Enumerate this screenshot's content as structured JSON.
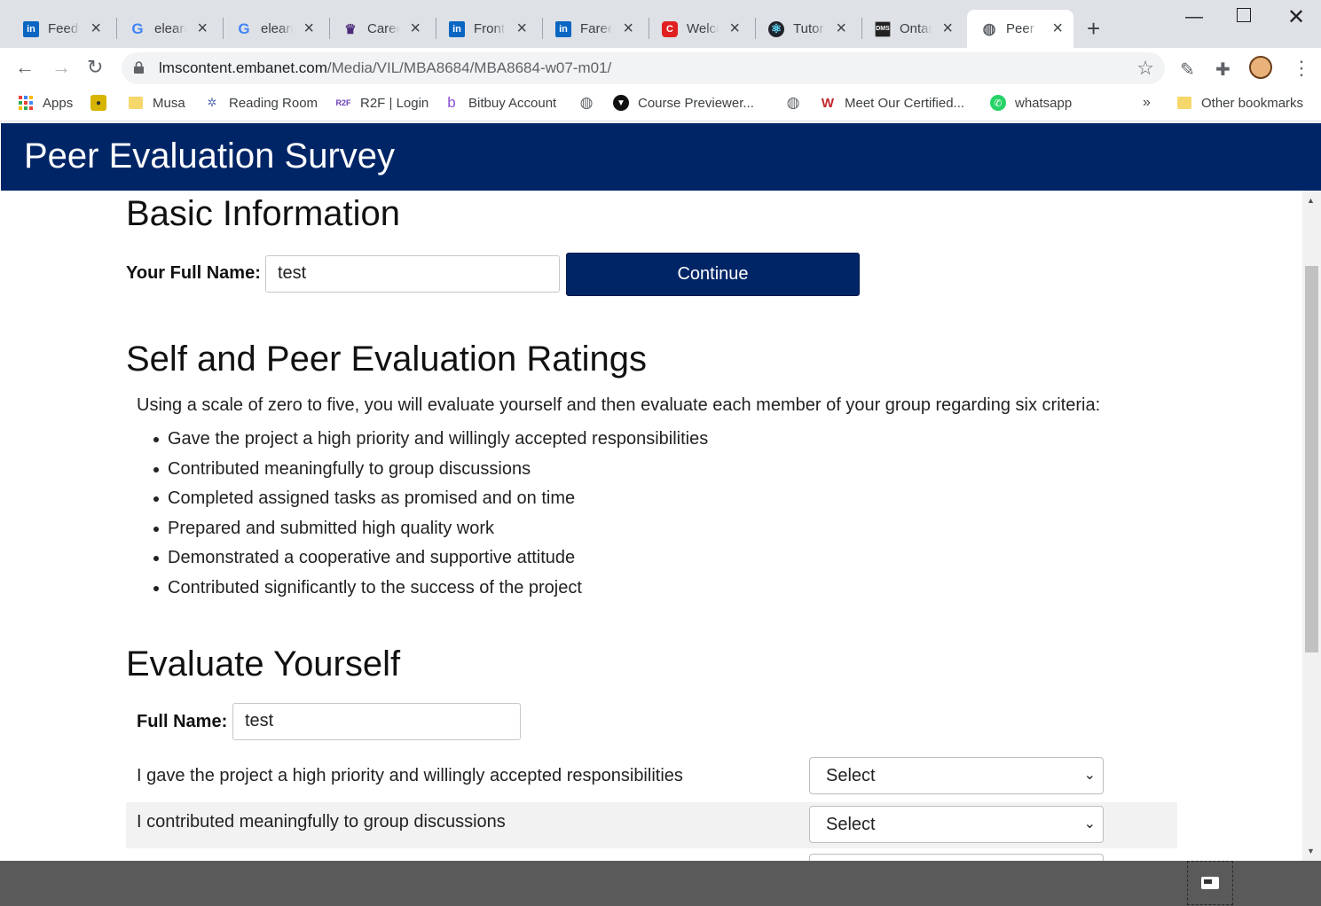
{
  "browser": {
    "tabs": [
      {
        "title": "Feed |",
        "icon": "linkedin-icon"
      },
      {
        "title": "elearn",
        "icon": "google-icon"
      },
      {
        "title": "elearn",
        "icon": "google-icon"
      },
      {
        "title": "Career",
        "icon": "crest-icon"
      },
      {
        "title": "Fronte",
        "icon": "linkedin-icon"
      },
      {
        "title": "Fareed",
        "icon": "linkedin-icon"
      },
      {
        "title": "Welco",
        "icon": "c-logo-icon"
      },
      {
        "title": "Tutori",
        "icon": "react-icon"
      },
      {
        "title": "Ontar",
        "icon": "dms-icon"
      },
      {
        "title": "Peer E",
        "icon": "globe-icon"
      }
    ],
    "url_host": "lmscontent.embanet.com",
    "url_path": "/Media/VIL/MBA8684/MBA8684-w07-m01/",
    "bookmarks": [
      {
        "label": "Apps",
        "icon": "apps-grid-icon"
      },
      {
        "label": "",
        "icon": "bookmark-image-icon"
      },
      {
        "label": "Musa",
        "icon": "folder-icon"
      },
      {
        "label": "Reading Room",
        "icon": "network-icon"
      },
      {
        "label": "R2F | Login",
        "icon": "r2f-icon"
      },
      {
        "label": "Bitbuy Account",
        "icon": "bitbuy-icon"
      },
      {
        "label": "",
        "icon": "globe-icon"
      },
      {
        "label": "Course Previewer...",
        "icon": "course-previewer-icon"
      },
      {
        "label": "",
        "icon": "globe-icon"
      },
      {
        "label": "Meet Our Certified...",
        "icon": "certified-icon"
      },
      {
        "label": "whatsapp",
        "icon": "whatsapp-icon"
      }
    ],
    "bookmarks_overflow": "»",
    "other_bookmarks": "Other bookmarks"
  },
  "page": {
    "title": "Peer Evaluation Survey",
    "basic": {
      "heading": "Basic Information",
      "name_label": "Your Full Name:",
      "name_value": "test",
      "continue_label": "Continue"
    },
    "ratings": {
      "heading": "Self and Peer Evaluation Ratings",
      "intro": "Using a scale of zero to five, you will evaluate yourself and then evaluate each member of your group regarding six criteria:",
      "criteria": [
        "Gave the project a high priority and willingly accepted responsibilities",
        "Contributed meaningfully to group discussions",
        "Completed assigned tasks as promised and on time",
        "Prepared and submitted high quality work",
        "Demonstrated a cooperative and supportive attitude",
        "Contributed significantly to the success of the project"
      ]
    },
    "self": {
      "heading": "Evaluate Yourself",
      "name_label": "Full Name:",
      "name_value": "test",
      "questions": [
        {
          "text": "I gave the project a high priority and willingly accepted responsibilities",
          "selected": "Select"
        },
        {
          "text": "I contributed meaningfully to group discussions",
          "selected": "Select"
        }
      ]
    }
  },
  "colors": {
    "brand": "#002566",
    "tabstrip": "#dee1e6"
  }
}
